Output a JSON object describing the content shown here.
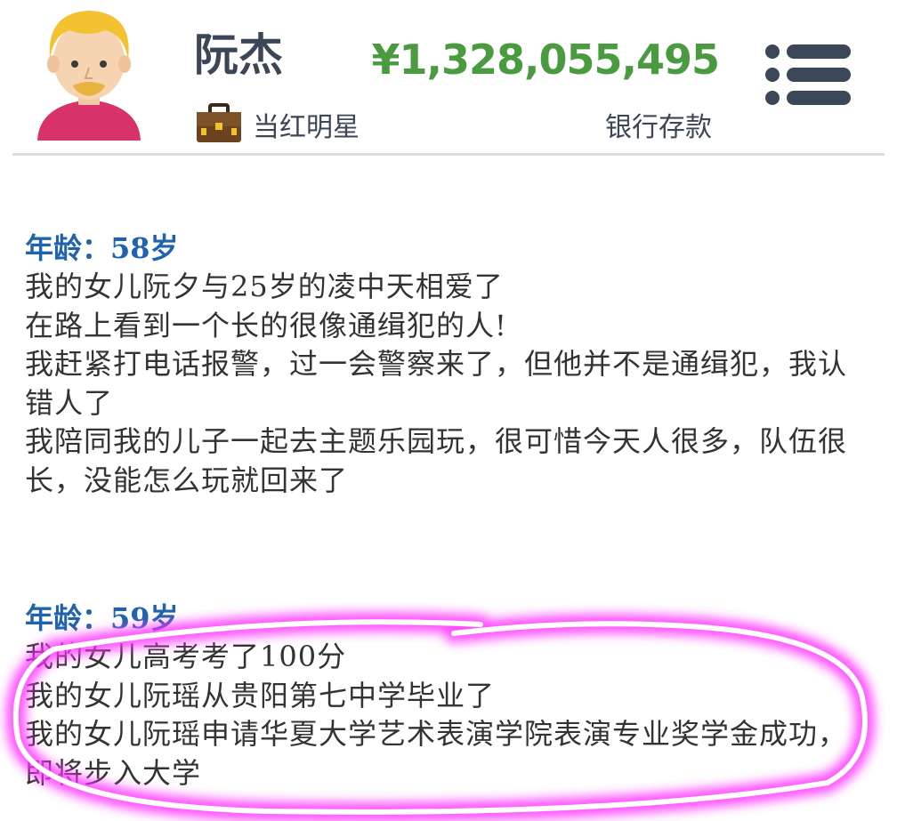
{
  "header": {
    "name": "阮杰",
    "occupation": "当红明星",
    "money": "¥1,328,055,495",
    "money_label": "银行存款"
  },
  "icons": {
    "avatar": "avatar-icon",
    "briefcase": "briefcase-icon",
    "menu": "menu-icon"
  },
  "colors": {
    "name": "#3b4656",
    "money": "#4a9a40",
    "age": "#1f63b0",
    "event_text": "#333333",
    "divider": "#dcdcdc",
    "highlight": "#ff33ff"
  },
  "years": [
    {
      "age": "年龄：58岁",
      "events": [
        "我的女儿阮夕与25岁的凌中天相爱了",
        "在路上看到一个长的很像通缉犯的人!",
        "我赶紧打电话报警，过一会警察来了，但他并不是通缉犯，我认错人了",
        "我陪同我的儿子一起去主题乐园玩，很可惜今天人很多，队伍很长，没能怎么玩就回来了"
      ]
    },
    {
      "age": "年龄：59岁",
      "events": [
        "我的女儿高考考了100分",
        "我的女儿阮瑶从贵阳第七中学毕业了",
        "我的女儿阮瑶申请华夏大学艺术表演学院表演专业奖学金成功，即将步入大学"
      ]
    }
  ]
}
